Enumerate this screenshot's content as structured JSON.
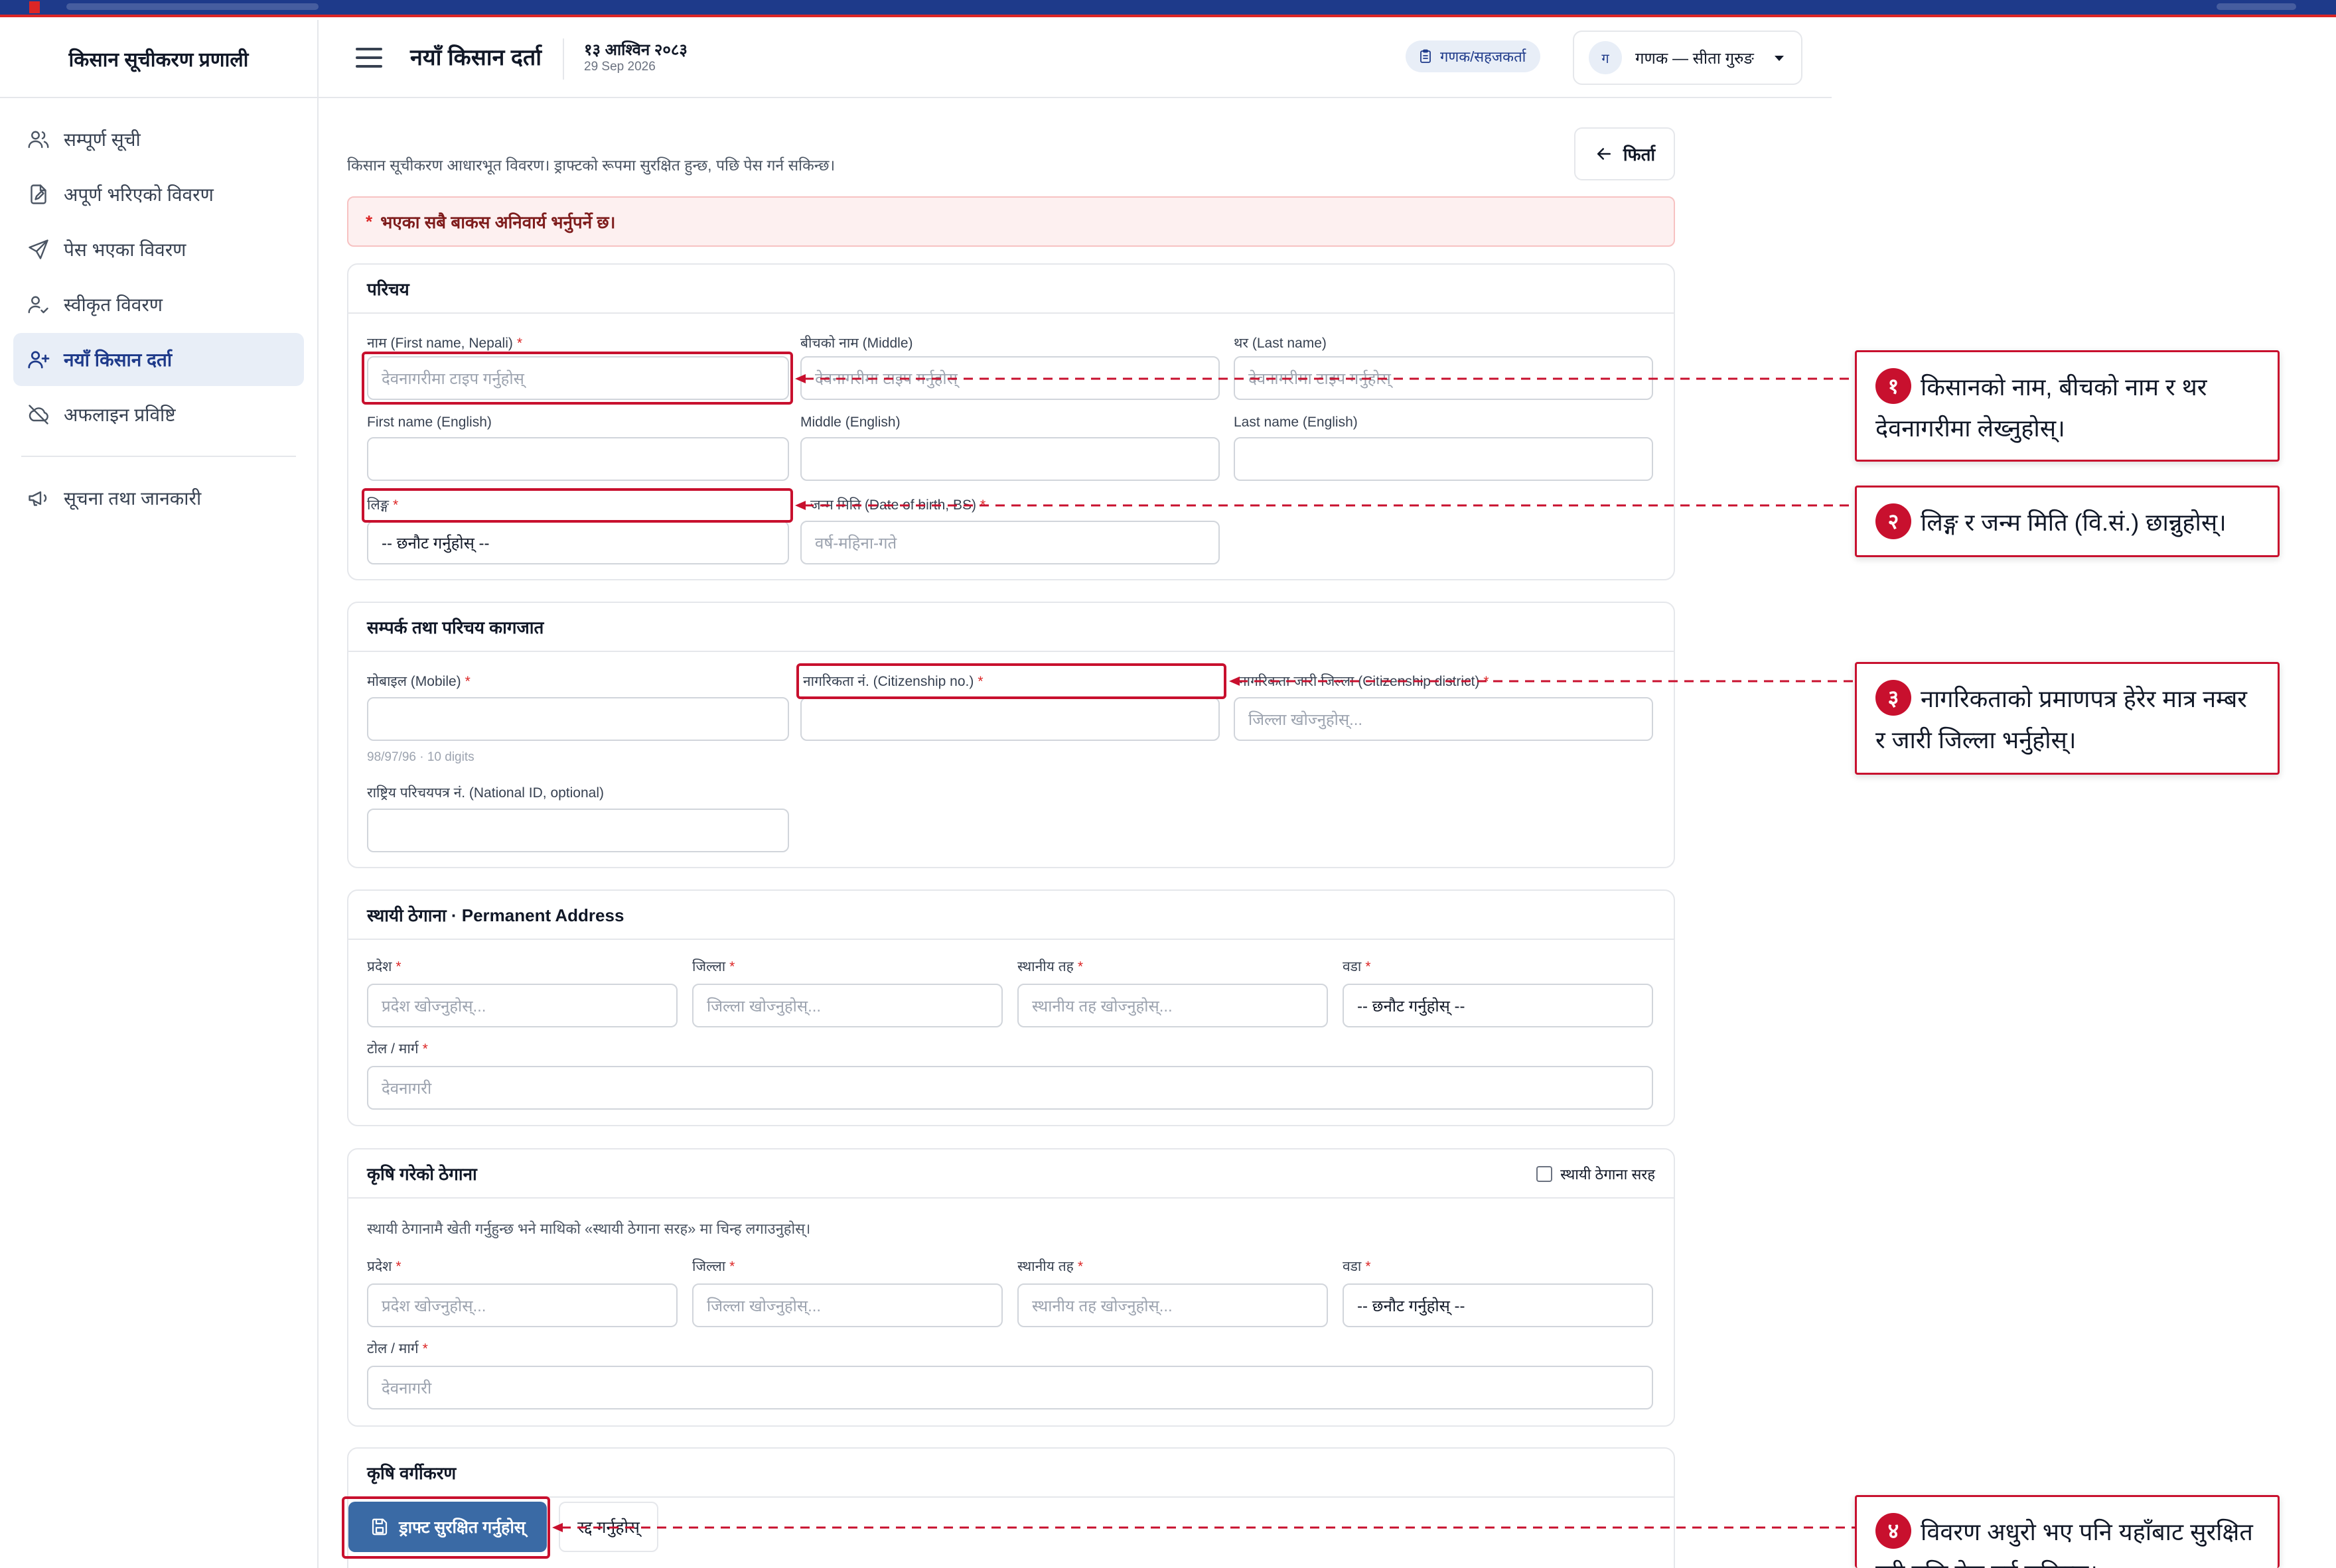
{
  "app": {
    "brand": "किसान सूचीकरण प्रणाली",
    "page_title": "नयाँ किसान दर्ता",
    "date_np": "१३ आश्विन २०८३",
    "date_en": "29 Sep 2026",
    "role_badge": "गणक/सहजकर्ता",
    "avatar_initial": "ग",
    "user_name": "गणक — सीता गुरुङ",
    "accent_color": "#1e3a8a",
    "annotation_color": "#c8102e"
  },
  "sidebar": {
    "items": [
      {
        "label": "सम्पूर्ण सूची",
        "icon": "users-icon"
      },
      {
        "label": "अपूर्ण भरिएको विवरण",
        "icon": "document-edit-icon"
      },
      {
        "label": "पेस भएका विवरण",
        "icon": "send-icon"
      },
      {
        "label": "स्वीकृत विवरण",
        "icon": "user-check-icon"
      },
      {
        "label": "नयाँ किसान दर्ता",
        "icon": "user-plus-icon",
        "active": true
      },
      {
        "label": "अफलाइन प्रविष्टि",
        "icon": "cloud-off-icon"
      }
    ],
    "footer_items": [
      {
        "label": "सूचना तथा जानकारी",
        "icon": "megaphone-icon"
      }
    ]
  },
  "page": {
    "intro": "किसान सूचीकरण आधारभूत विवरण। ड्राफ्टको रूपमा सुरक्षित हुन्छ, पछि पेस गर्न सकिन्छ।",
    "back_label": "फिर्ता",
    "required_star": "*",
    "required_notice": "भएका सबै बाकस अनिवार्य भर्नुपर्ने छ।"
  },
  "intro_section": {
    "title": "परिचय",
    "first_name_np": {
      "label": "नाम (First name, Nepali)",
      "placeholder": "देवनागरीमा टाइप गर्नुहोस्"
    },
    "middle_np": {
      "label": "बीचको नाम (Middle)",
      "placeholder": "देवनागरीमा टाइप गर्नुहोस्"
    },
    "last_np": {
      "label": "थर (Last name)",
      "placeholder": "देवनागरीमा टाइप गर्नुहोस्"
    },
    "first_en": {
      "label": "First name (English)"
    },
    "middle_en": {
      "label": "Middle (English)"
    },
    "last_en": {
      "label": "Last name (English)"
    },
    "gender": {
      "label": "लिङ्ग",
      "value": "-- छनौट गर्नुहोस् --"
    },
    "dob": {
      "label": "जन्म मिति (Date of birth, BS)",
      "placeholder": "वर्ष-महिना-गते"
    }
  },
  "contact_section": {
    "title": "सम्पर्क तथा परिचय कागजात",
    "mobile": {
      "label": "मोबाइल (Mobile)",
      "hint": "98/97/96 · 10 digits"
    },
    "citizenship_no": {
      "label": "नागरिकता नं. (Citizenship no.)"
    },
    "citizenship_district": {
      "label": "नागरिकता जारी जिल्ला (Citizenship district)",
      "placeholder": "जिल्ला खोज्नुहोस्..."
    },
    "national_id": {
      "label": "राष्ट्रिय परिचयपत्र नं. (National ID, optional)"
    }
  },
  "permanent_address": {
    "title": "स्थायी ठेगाना · Permanent Address",
    "province": {
      "label": "प्रदेश",
      "placeholder": "प्रदेश खोज्नुहोस्..."
    },
    "district": {
      "label": "जिल्ला",
      "placeholder": "जिल्ला खोज्नुहोस्..."
    },
    "local_level": {
      "label": "स्थानीय तह",
      "placeholder": "स्थानीय तह खोज्नुहोस्..."
    },
    "ward": {
      "label": "वडा",
      "value": "-- छनौट गर्नुहोस् --"
    },
    "tole": {
      "label": "टोल / मार्ग",
      "placeholder": "देवनागरी"
    }
  },
  "farm_address": {
    "title": "कृषि गरेको ठेगाना",
    "same_label": "स्थायी ठेगाना सरह",
    "same_checked": false,
    "note": "स्थायी ठेगानामै खेती गर्नुहुन्छ भने माथिको «स्थायी ठेगाना सरह» मा चिन्ह लगाउनुहोस्।",
    "province": {
      "label": "प्रदेश",
      "placeholder": "प्रदेश खोज्नुहोस्..."
    },
    "district": {
      "label": "जिल्ला",
      "placeholder": "जिल्ला खोज्नुहोस्..."
    },
    "local_level": {
      "label": "स्थानीय तह",
      "placeholder": "स्थानीय तह खोज्नुहोस्..."
    },
    "ward": {
      "label": "वडा",
      "value": "-- छनौट गर्नुहोस् --"
    },
    "tole": {
      "label": "टोल / मार्ग",
      "placeholder": "देवनागरी"
    }
  },
  "classification": {
    "title": "कृषि वर्गीकरण"
  },
  "actions": {
    "save_draft": "ड्राफ्ट सुरक्षित गर्नुहोस्",
    "cancel": "रद्द गर्नुहोस्"
  },
  "callouts": [
    {
      "num": "१",
      "text": "किसानको नाम, बीचको नाम र थर देवनागरीमा लेख्नुहोस्।"
    },
    {
      "num": "२",
      "text": "लिङ्ग र जन्म मिति (वि.सं.) छान्नुहोस्।"
    },
    {
      "num": "३",
      "text": "नागरिकताको प्रमाणपत्र हेरेर मात्र नम्बर र जारी जिल्ला भर्नुहोस्।"
    },
    {
      "num": "४",
      "text": "विवरण अधुरो भए पनि यहाँबाट सुरक्षित गरी पछि पेस गर्न सकिन्छ।"
    }
  ]
}
